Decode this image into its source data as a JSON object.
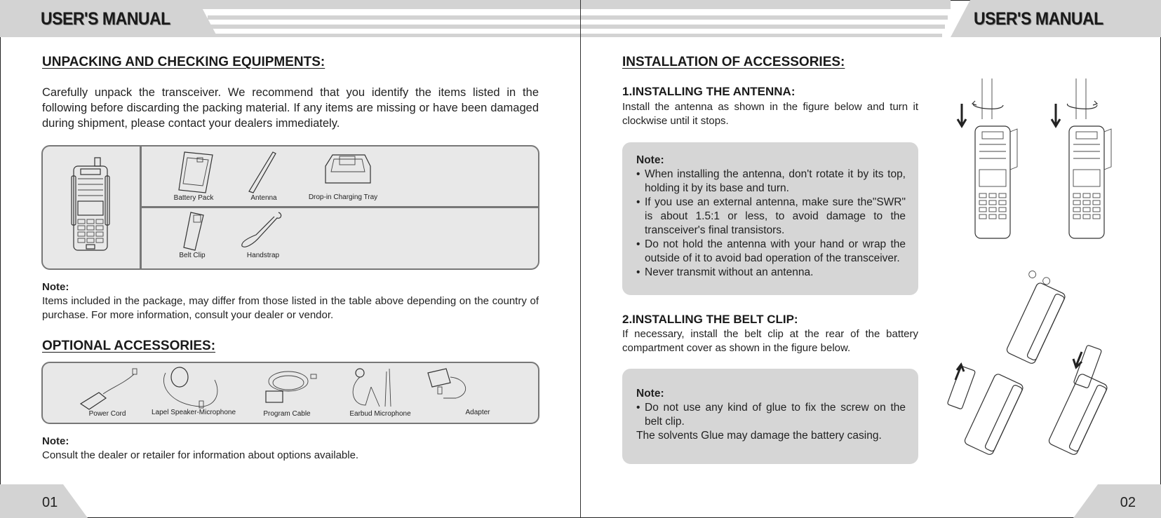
{
  "header": {
    "title_left": "USER'S MANUAL",
    "title_right": "USER'S MANUAL"
  },
  "left_page": {
    "page_number": "01",
    "unpacking": {
      "heading": "UNPACKING AND CHECKING EQUIPMENTS:",
      "paragraph": "Carefully unpack the transceiver. We recommend that you identify the items listed in the following before discarding the packing material. If any items are missing or have been damaged during shipment, please contact your dealers immediately.",
      "items_row1": [
        "Battery Pack",
        "Antenna",
        "Drop-in Charging Tray"
      ],
      "items_row2": [
        "Belt Clip",
        "Handstrap"
      ],
      "note_title": "Note:",
      "note_text": "Items included in the package, may differ from those listed in the table above depending on the country of purchase. For more information, consult your dealer or vendor."
    },
    "optional": {
      "heading": "OPTIONAL ACCESSORIES:",
      "items": [
        "Power Cord",
        "Lapel Speaker-Microphone",
        "Program Cable",
        "Earbud Microphone",
        "Adapter"
      ],
      "note_title": "Note:",
      "note_text": "Consult the dealer or retailer for information about options available."
    }
  },
  "right_page": {
    "page_number": "02",
    "heading": "INSTALLATION OF ACCESSORIES:",
    "antenna": {
      "title": "1.INSTALLING THE ANTENNA:",
      "text": "Install the antenna as shown in the figure below and turn it clockwise until it stops.",
      "note_title": "Note:",
      "bullets": [
        "When installing the antenna, don't rotate it by its top, holding it by its base and turn.",
        "If you use an external antenna, make sure the\"SWR\" is about 1.5:1 or less, to avoid damage to the transceiver's final transistors.",
        "Do not hold the antenna with your hand or wrap the outside of it to avoid bad operation of the transceiver.",
        "Never transmit without an antenna."
      ]
    },
    "belt_clip": {
      "title": "2.INSTALLING THE BELT CLIP:",
      "text": "If necessary, install the belt clip at the rear of the battery compartment cover as shown in the figure below.",
      "note_title": "Note:",
      "bullet": "Do not use any kind of glue to fix the screw on the belt clip.",
      "extra": "The solvents Glue may damage the battery casing."
    }
  }
}
